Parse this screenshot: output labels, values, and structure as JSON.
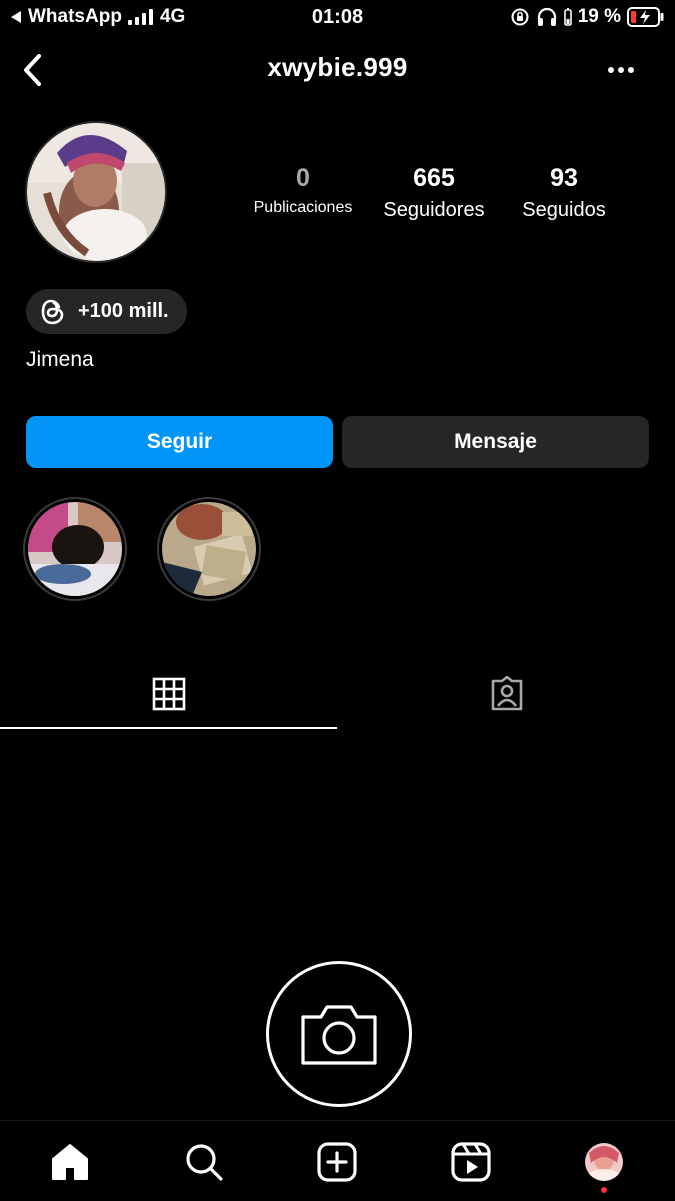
{
  "status_bar": {
    "back_app": "WhatsApp",
    "network": "4G",
    "time": "01:08",
    "battery": "19 %"
  },
  "header": {
    "username": "xwybie.999"
  },
  "profile": {
    "name": "Jimena",
    "threads_badge": "+100 mill.",
    "stats": [
      {
        "value": "0",
        "label": "Publicaciones"
      },
      {
        "value": "665",
        "label": "Seguidores"
      },
      {
        "value": "93",
        "label": "Seguidos"
      }
    ]
  },
  "actions": {
    "follow_label": "Seguir",
    "message_label": "Mensaje"
  },
  "colors": {
    "accent": "#0095f6",
    "background": "#000000",
    "secondary_button": "#262626",
    "notification_dot": "#ff3040",
    "battery_low": "#ff3b30"
  },
  "tabs": [
    {
      "icon": "grid-icon",
      "active": true
    },
    {
      "icon": "tagged-icon",
      "active": false
    }
  ],
  "bottom_nav": [
    "home-icon",
    "search-icon",
    "create-icon",
    "reels-icon",
    "profile-avatar"
  ]
}
